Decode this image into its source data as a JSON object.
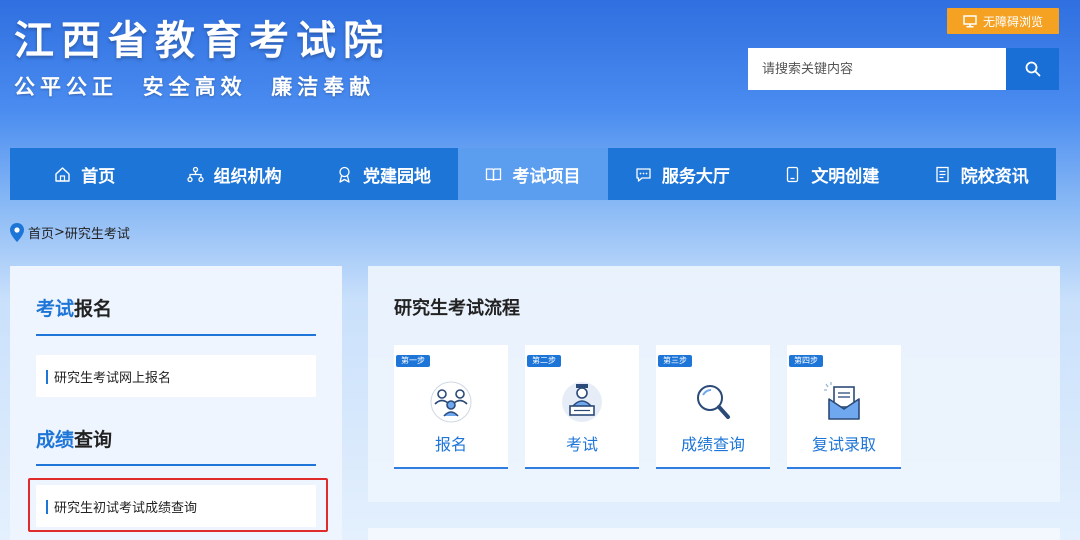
{
  "header": {
    "title": "江西省教育考试院",
    "slogan": "公平公正  安全高效  廉洁奉献",
    "accessibility_label": "无障碍浏览",
    "search_placeholder": "请搜索关键内容"
  },
  "nav": {
    "items": [
      {
        "label": "首页",
        "icon": "home-icon"
      },
      {
        "label": "组织机构",
        "icon": "org-chart-icon"
      },
      {
        "label": "党建园地",
        "icon": "badge-icon"
      },
      {
        "label": "考试项目",
        "icon": "book-icon",
        "active": true
      },
      {
        "label": "服务大厅",
        "icon": "chat-icon"
      },
      {
        "label": "文明创建",
        "icon": "tablet-icon"
      },
      {
        "label": "院校资讯",
        "icon": "document-icon"
      }
    ]
  },
  "breadcrumb": {
    "home": "首页",
    "separator": ">",
    "current": "研究生考试"
  },
  "sidebar": {
    "section1": {
      "accent": "考试",
      "rest": "报名",
      "link": "研究生考试网上报名"
    },
    "section2": {
      "accent": "成绩",
      "rest": "查询",
      "link": "研究生初试考试成绩查询"
    }
  },
  "main": {
    "title": "研究生考试流程",
    "steps": [
      {
        "tag": "第一步",
        "label": "报名",
        "icon": "people-group-icon"
      },
      {
        "tag": "第二步",
        "label": "考试",
        "icon": "exam-candidate-icon"
      },
      {
        "tag": "第三步",
        "label": "成绩查询",
        "icon": "magnifier-icon"
      },
      {
        "tag": "第四步",
        "label": "复试录取",
        "icon": "envelope-letter-icon"
      }
    ]
  },
  "colors": {
    "primary": "#1e75d8",
    "nav_active": "#5b9ef0",
    "accessibility_button": "#f5a223",
    "highlight": "#e02b2b"
  }
}
